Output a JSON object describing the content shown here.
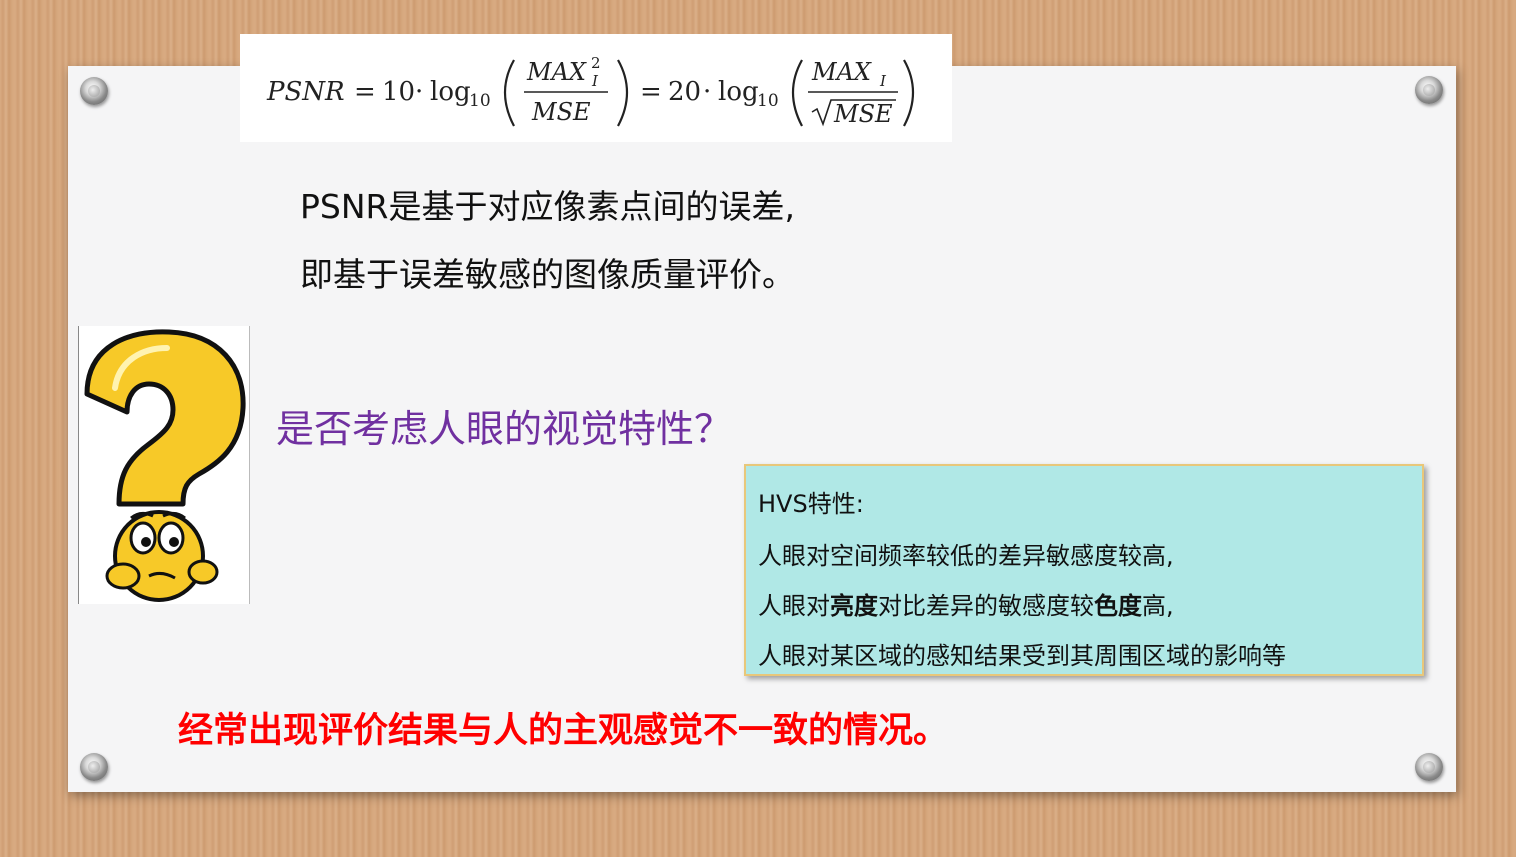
{
  "formula": {
    "psnr": "PSNR",
    "eq": "=",
    "ten": "10",
    "dot": "·",
    "log": "log",
    "sub10": "10",
    "max": "MAX",
    "max_sup": "2",
    "max_sub": "I",
    "mse": "MSE",
    "twenty": "20"
  },
  "description": {
    "line1": "PSNR是基于对应像素点间的误差,",
    "line2": "即基于误差敏感的图像质量评价。"
  },
  "question": "是否考虑人眼的视觉特性？",
  "hvs": {
    "title": "HVS特性:",
    "line1": "人眼对空间频率较低的差异敏感度较高,",
    "line2_a": "人眼对",
    "line2_b": "亮度",
    "line2_c": "对比差异的敏感度较",
    "line2_d": "色度",
    "line2_e": "高,",
    "line3": "人眼对某区域的感知结果受到其周围区域的影响等"
  },
  "conclusion": "经常出现评价结果与人的主观感觉不一致的情况。",
  "colors": {
    "question": "#7030a0",
    "conclusion": "#ff0000",
    "hvs_bg": "#b0e8e6",
    "icon_yellow": "#f7c928"
  },
  "icons": [
    "pushpin-icon",
    "question-mark-icon",
    "thinking-face-icon"
  ]
}
